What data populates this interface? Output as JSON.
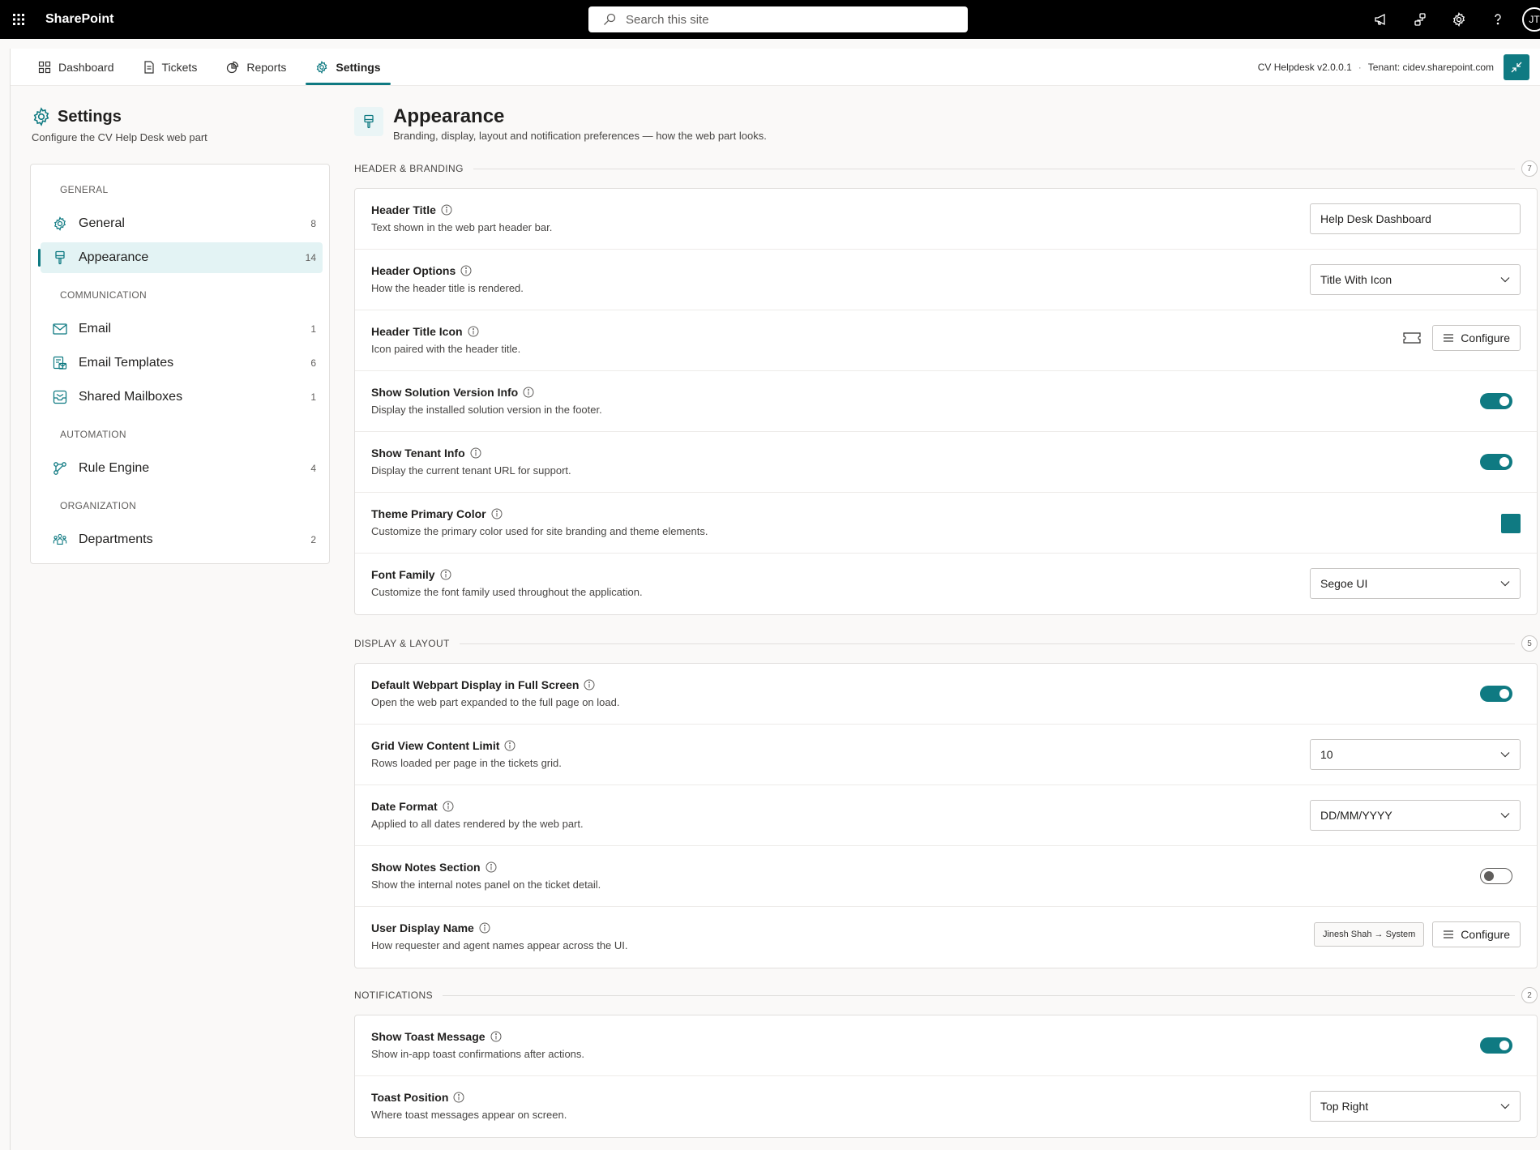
{
  "suite": {
    "brand": "SharePoint",
    "search_placeholder": "Search this site",
    "avatar_initials": "JT"
  },
  "nav": {
    "tabs": [
      {
        "label": "Dashboard",
        "icon": "dashboard-icon"
      },
      {
        "label": "Tickets",
        "icon": "document-icon"
      },
      {
        "label": "Reports",
        "icon": "report-icon"
      },
      {
        "label": "Settings",
        "icon": "gear-icon",
        "active": true
      }
    ],
    "version": "CV Helpdesk v2.0.0.1",
    "tenant": "Tenant: cidev.sharepoint.com"
  },
  "settings": {
    "title": "Settings",
    "subtitle": "Configure the CV Help Desk web part",
    "groups": {
      "general": "GENERAL",
      "communication": "COMMUNICATION",
      "automation": "AUTOMATION",
      "organization": "ORGANIZATION"
    },
    "items": [
      {
        "label": "General",
        "count": "8"
      },
      {
        "label": "Appearance",
        "count": "14"
      },
      {
        "label": "Email",
        "count": "1"
      },
      {
        "label": "Email Templates",
        "count": "6"
      },
      {
        "label": "Shared Mailboxes",
        "count": "1"
      },
      {
        "label": "Rule Engine",
        "count": "4"
      },
      {
        "label": "Departments",
        "count": "2"
      }
    ]
  },
  "page": {
    "title": "Appearance",
    "subtitle": "Branding, display, layout and notification preferences — how the web part looks."
  },
  "sections": {
    "header": {
      "title": "HEADER & BRANDING",
      "count": "7",
      "rows": [
        {
          "label": "Header Title",
          "desc": "Text shown in the web part header bar.",
          "value": "Help Desk Dashboard"
        },
        {
          "label": "Header Options",
          "desc": "How the header title is rendered.",
          "value": "Title With Icon"
        },
        {
          "label": "Header Title Icon",
          "desc": "Icon paired with the header title.",
          "button": "Configure"
        },
        {
          "label": "Show Solution Version Info",
          "desc": "Display the installed solution version in the footer.",
          "on": true
        },
        {
          "label": "Show Tenant Info",
          "desc": "Display the current tenant URL for support.",
          "on": true
        },
        {
          "label": "Theme Primary Color",
          "desc": "Customize the primary color used for site branding and theme elements.",
          "color": "#0f7a82"
        },
        {
          "label": "Font Family",
          "desc": "Customize the font family used throughout the application.",
          "value": "Segoe UI"
        }
      ]
    },
    "display": {
      "title": "DISPLAY & LAYOUT",
      "count": "5",
      "rows": [
        {
          "label": "Default Webpart Display in Full Screen",
          "desc": "Open the web part expanded to the full page on load.",
          "on": true
        },
        {
          "label": "Grid View Content Limit",
          "desc": "Rows loaded per page in the tickets grid.",
          "value": "10"
        },
        {
          "label": "Date Format",
          "desc": "Applied to all dates rendered by the web part.",
          "value": "DD/MM/YYYY"
        },
        {
          "label": "Show Notes Section",
          "desc": "Show the internal notes panel on the ticket detail.",
          "on": false
        },
        {
          "label": "User Display Name",
          "desc": "How requester and agent names appear across the UI.",
          "chip": "Jinesh Shah → System",
          "button": "Configure"
        }
      ]
    },
    "notifications": {
      "title": "NOTIFICATIONS",
      "count": "2",
      "rows": [
        {
          "label": "Show Toast Message",
          "desc": "Show in-app toast confirmations after actions.",
          "on": true
        },
        {
          "label": "Toast Position",
          "desc": "Where toast messages appear on screen.",
          "value": "Top Right"
        }
      ]
    }
  },
  "colors": {
    "accent": "#0f7a82",
    "suitebar": "#000000"
  }
}
